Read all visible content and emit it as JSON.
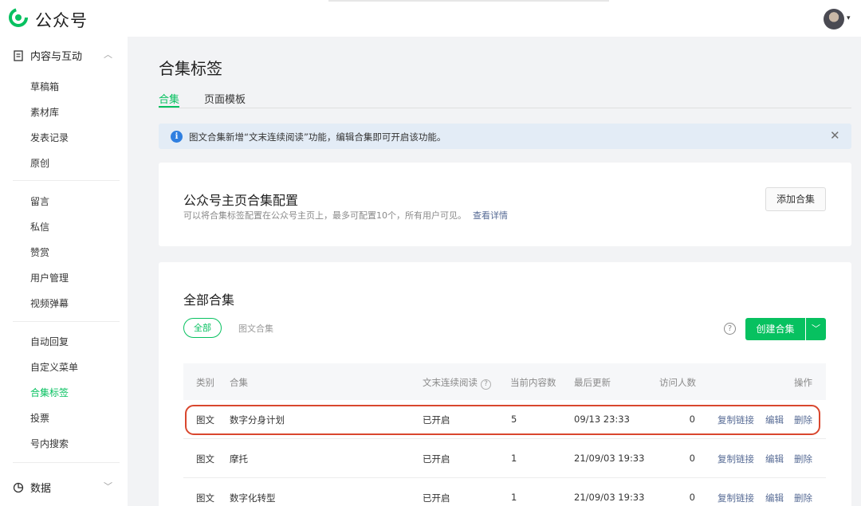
{
  "app": {
    "brand": "公众号",
    "brand_color": "#07c160"
  },
  "sidebar": {
    "group_content": {
      "label": "内容与互动",
      "icon": "document-icon",
      "caret": "︿"
    },
    "items_a": [
      "草稿箱",
      "素材库",
      "发表记录",
      "原创"
    ],
    "items_b": [
      "留言",
      "私信",
      "赞赏",
      "用户管理",
      "视频弹幕"
    ],
    "items_c": [
      "自动回复",
      "自定义菜单",
      "合集标签",
      "投票",
      "号内搜索"
    ],
    "active_item": "合集标签",
    "group_data": {
      "label": "数据",
      "icon": "chart-icon",
      "caret": "﹀"
    }
  },
  "page": {
    "title": "合集标签",
    "tabs": [
      "合集",
      "页面模板"
    ]
  },
  "banner": {
    "text": "图文合集新增“文末连续阅读”功能，编辑合集即可开启该功能。",
    "close": "✕"
  },
  "homepage_config": {
    "title": "公众号主页合集配置",
    "desc": "可以将合集标签配置在公众号主页上，最多可配置10个，所有用户可见。",
    "link": "查看详情",
    "add_button": "添加合集"
  },
  "all_collections": {
    "title": "全部合集",
    "filters": [
      "全部",
      "图文合集"
    ],
    "help": "?",
    "create_button": "创建合集",
    "create_dropdown": "﹀",
    "columns": [
      "类别",
      "合集",
      "文末连续阅读",
      "当前内容数",
      "最后更新",
      "访问人数",
      "操作"
    ],
    "column_help": "?",
    "rows": [
      {
        "type": "图文",
        "name": "数字分身计划",
        "continuous": "已开启",
        "count": "5",
        "updated": "09/13 23:33",
        "visitors": "0",
        "actions": [
          "复制链接",
          "编辑",
          "删除"
        ]
      },
      {
        "type": "图文",
        "name": "摩托",
        "continuous": "已开启",
        "count": "1",
        "updated": "21/09/03 19:33",
        "visitors": "0",
        "actions": [
          "复制链接",
          "编辑",
          "删除"
        ]
      },
      {
        "type": "图文",
        "name": "数字化转型",
        "continuous": "已开启",
        "count": "1",
        "updated": "21/09/03 19:33",
        "visitors": "0",
        "actions": [
          "复制链接",
          "编辑",
          "删除"
        ]
      }
    ],
    "highlighted_row": 0,
    "highlight_color": "#d9472e"
  }
}
